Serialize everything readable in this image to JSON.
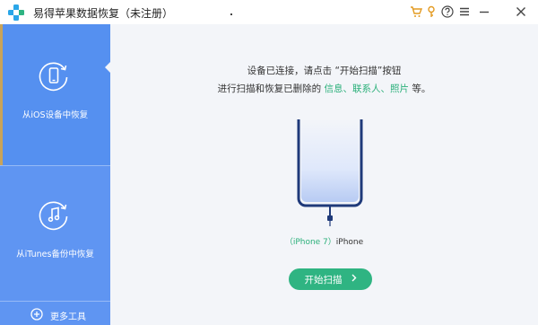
{
  "window": {
    "title": "易得苹果数据恢复（未注册）",
    "controls": [
      {
        "name": "cart-icon",
        "color": "#e39b22"
      },
      {
        "name": "key-icon",
        "color": "#e39b22"
      },
      {
        "name": "help-icon"
      },
      {
        "name": "menu-icon"
      },
      {
        "name": "minimize-icon"
      },
      {
        "name": "close-icon"
      }
    ]
  },
  "sidebar": {
    "items": [
      {
        "label": "从iOS设备中恢复",
        "icon": "phone-restore-icon",
        "active": true
      },
      {
        "label": "从iTunes备份中恢复",
        "icon": "music-restore-icon",
        "active": false
      }
    ],
    "more_tools": "更多工具"
  },
  "main": {
    "instruction_line1": "设备已连接，请点击 “开始扫描”按钮",
    "instruction_line2_prefix": "进行扫描和恢复已删除的",
    "instruction_line2_highlight": "信息、联系人、照片",
    "instruction_line2_suffix": "等。",
    "device_model": "（iPhone 7）",
    "device_name": "iPhone",
    "start_button": "开始扫描"
  },
  "colors": {
    "sidebar": "#5f95f2",
    "accent_green": "#2fb482",
    "highlight_green": "#2bb07a",
    "main_bg": "#f3f5f9",
    "phone_dark": "#1f3a7a"
  }
}
